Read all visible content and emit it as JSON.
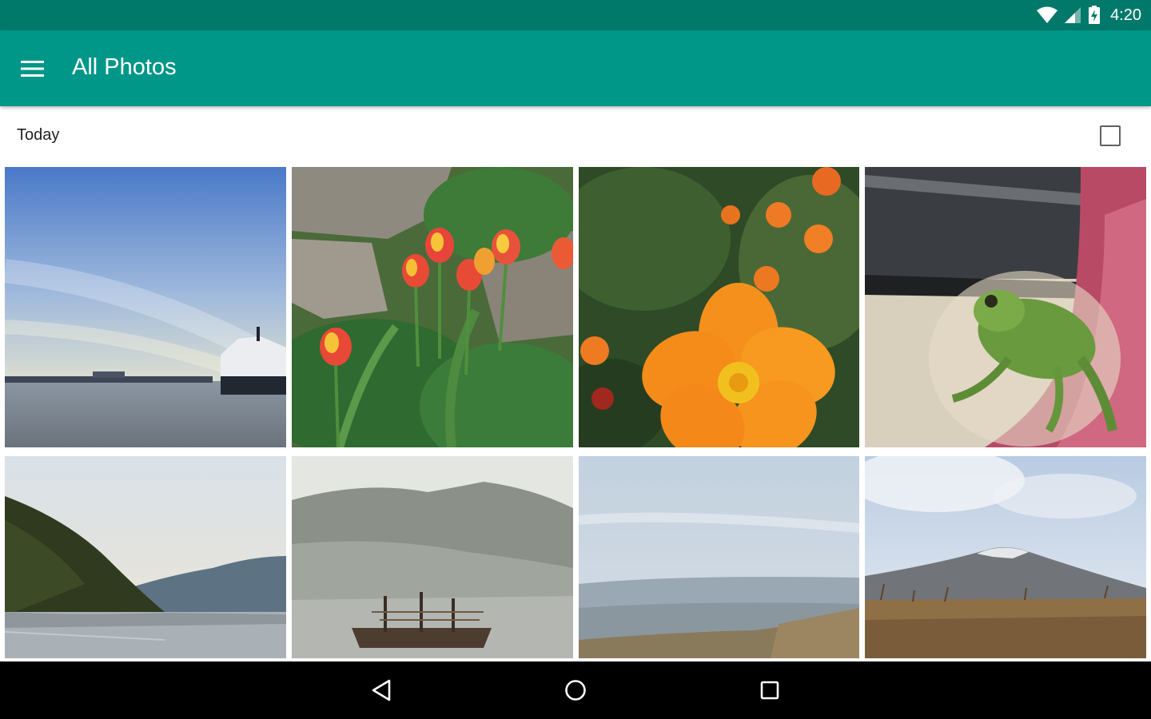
{
  "status_bar": {
    "time": "4:20",
    "icons": [
      "wifi-icon",
      "cellular-signal-icon",
      "battery-charging-icon"
    ]
  },
  "app_bar": {
    "title": "All Photos",
    "menu_icon": "hamburger-menu-icon",
    "color": "#009688"
  },
  "section": {
    "label": "Today"
  },
  "photos": [
    {
      "subject": "harbor-sunset"
    },
    {
      "subject": "tulips"
    },
    {
      "subject": "orange-cosmos"
    },
    {
      "subject": "tree-frog"
    },
    {
      "subject": "lake-hills"
    },
    {
      "subject": "pirate-ship-mountain"
    },
    {
      "subject": "hazy-valley"
    },
    {
      "subject": "mount-fuji"
    }
  ],
  "nav_bar": {
    "buttons": [
      "back-icon",
      "home-icon",
      "recents-icon"
    ]
  }
}
